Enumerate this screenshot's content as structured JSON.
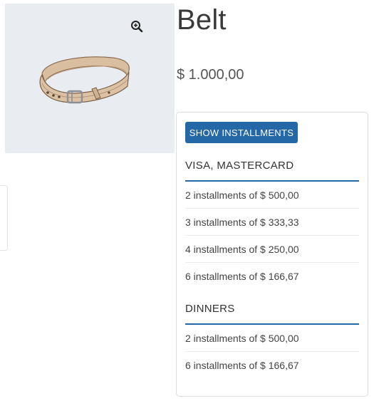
{
  "product": {
    "title": "Belt",
    "price": "$ 1.000,00",
    "zoom_icon": "zoom-in-icon",
    "image": "belt-product-image"
  },
  "installments": {
    "button_label": "SHOW INSTALLMENTS",
    "accent_color": "#2468a7",
    "groups": [
      {
        "name": "VISA, MASTERCARD",
        "rows": [
          "2 installments of $ 500,00",
          "3 installments of $ 333,33",
          "4 installments of $ 250,00",
          "6 installments of $ 166,67"
        ]
      },
      {
        "name": "DINNERS",
        "rows": [
          "2 installments of $ 500,00",
          "6 installments of $ 166,67"
        ]
      }
    ]
  }
}
